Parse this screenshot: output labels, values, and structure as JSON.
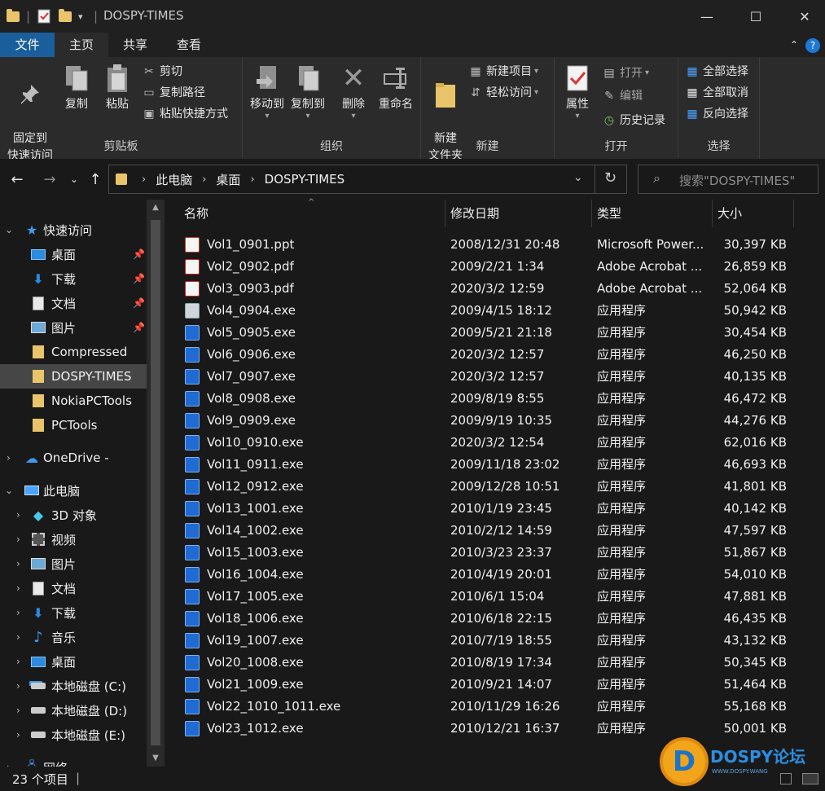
{
  "window": {
    "title": "DOSPY-TIMES",
    "minimize": "—",
    "maximize": "☐",
    "close": "✕"
  },
  "ribbon_tabs": [
    "文件",
    "主页",
    "共享",
    "查看"
  ],
  "ribbon": {
    "clipboard": {
      "label": "剪贴板",
      "pin": "固定到\n快速访问",
      "copy": "复制",
      "paste": "粘贴",
      "cut": "剪切",
      "copy_path": "复制路径",
      "paste_shortcut": "粘贴快捷方式"
    },
    "organize": {
      "label": "组织",
      "move_to": "移动到",
      "copy_to": "复制到",
      "delete": "删除",
      "rename": "重命名"
    },
    "new": {
      "label": "新建",
      "new_folder": "新建\n文件夹",
      "new_item": "新建项目",
      "easy_access": "轻松访问"
    },
    "open": {
      "label": "打开",
      "properties": "属性",
      "open": "打开",
      "edit": "编辑",
      "history": "历史记录"
    },
    "select": {
      "label": "选择",
      "select_all": "全部选择",
      "select_none": "全部取消",
      "invert": "反向选择"
    }
  },
  "address": {
    "crumbs": [
      "此电脑",
      "桌面",
      "DOSPY-TIMES"
    ],
    "search_placeholder": "搜索\"DOSPY-TIMES\""
  },
  "nav": {
    "quick_access": "快速访问",
    "quick_items": [
      "桌面",
      "下载",
      "文档",
      "图片",
      "Compressed",
      "DOSPY-TIMES",
      "NokiaPCTools",
      "PCTools"
    ],
    "onedrive": "OneDrive -",
    "this_pc": "此电脑",
    "pc_items": [
      "3D 对象",
      "视频",
      "图片",
      "文档",
      "下载",
      "音乐",
      "桌面",
      "本地磁盘 (C:)",
      "本地磁盘 (D:)",
      "本地磁盘 (E:)"
    ],
    "network": "网络"
  },
  "columns": [
    "名称",
    "修改日期",
    "类型",
    "大小"
  ],
  "files": [
    {
      "name": "Vol1_0901.ppt",
      "date": "2008/12/31 20:48",
      "type": "Microsoft Power...",
      "size": "30,397 KB",
      "icon": "ppt"
    },
    {
      "name": "Vol2_0902.pdf",
      "date": "2009/2/21 1:34",
      "type": "Adobe Acrobat ...",
      "size": "26,859 KB",
      "icon": "pdf"
    },
    {
      "name": "Vol3_0903.pdf",
      "date": "2020/3/2 12:59",
      "type": "Adobe Acrobat ...",
      "size": "52,064 KB",
      "icon": "pdf"
    },
    {
      "name": "Vol4_0904.exe",
      "date": "2009/4/15 18:12",
      "type": "应用程序",
      "size": "50,942 KB",
      "icon": "exe2"
    },
    {
      "name": "Vol5_0905.exe",
      "date": "2009/5/21 21:18",
      "type": "应用程序",
      "size": "30,454 KB",
      "icon": "exe"
    },
    {
      "name": "Vol6_0906.exe",
      "date": "2020/3/2 12:57",
      "type": "应用程序",
      "size": "46,250 KB",
      "icon": "exe"
    },
    {
      "name": "Vol7_0907.exe",
      "date": "2020/3/2 12:57",
      "type": "应用程序",
      "size": "40,135 KB",
      "icon": "exe"
    },
    {
      "name": "Vol8_0908.exe",
      "date": "2009/8/19 8:55",
      "type": "应用程序",
      "size": "46,472 KB",
      "icon": "exe"
    },
    {
      "name": "Vol9_0909.exe",
      "date": "2009/9/19 10:35",
      "type": "应用程序",
      "size": "44,276 KB",
      "icon": "exe"
    },
    {
      "name": "Vol10_0910.exe",
      "date": "2020/3/2 12:54",
      "type": "应用程序",
      "size": "62,016 KB",
      "icon": "exe"
    },
    {
      "name": "Vol11_0911.exe",
      "date": "2009/11/18 23:02",
      "type": "应用程序",
      "size": "46,693 KB",
      "icon": "exe"
    },
    {
      "name": "Vol12_0912.exe",
      "date": "2009/12/28 10:51",
      "type": "应用程序",
      "size": "41,801 KB",
      "icon": "exe"
    },
    {
      "name": "Vol13_1001.exe",
      "date": "2010/1/19 23:45",
      "type": "应用程序",
      "size": "40,142 KB",
      "icon": "exe"
    },
    {
      "name": "Vol14_1002.exe",
      "date": "2010/2/12 14:59",
      "type": "应用程序",
      "size": "47,597 KB",
      "icon": "exe"
    },
    {
      "name": "Vol15_1003.exe",
      "date": "2010/3/23 23:37",
      "type": "应用程序",
      "size": "51,867 KB",
      "icon": "exe"
    },
    {
      "name": "Vol16_1004.exe",
      "date": "2010/4/19 20:01",
      "type": "应用程序",
      "size": "54,010 KB",
      "icon": "exe"
    },
    {
      "name": "Vol17_1005.exe",
      "date": "2010/6/1 15:04",
      "type": "应用程序",
      "size": "47,881 KB",
      "icon": "exe"
    },
    {
      "name": "Vol18_1006.exe",
      "date": "2010/6/18 22:15",
      "type": "应用程序",
      "size": "46,435 KB",
      "icon": "exe"
    },
    {
      "name": "Vol19_1007.exe",
      "date": "2010/7/19 18:55",
      "type": "应用程序",
      "size": "43,132 KB",
      "icon": "exe"
    },
    {
      "name": "Vol20_1008.exe",
      "date": "2010/8/19 17:34",
      "type": "应用程序",
      "size": "50,345 KB",
      "icon": "exe"
    },
    {
      "name": "Vol21_1009.exe",
      "date": "2010/9/21 14:07",
      "type": "应用程序",
      "size": "51,464 KB",
      "icon": "exe"
    },
    {
      "name": "Vol22_1010_1011.exe",
      "date": "2010/11/29 16:26",
      "type": "应用程序",
      "size": "55,168 KB",
      "icon": "exe"
    },
    {
      "name": "Vol23_1012.exe",
      "date": "2010/12/21 16:37",
      "type": "应用程序",
      "size": "50,001 KB",
      "icon": "exe"
    }
  ],
  "status": {
    "count": "23 个项目",
    "separator": "|"
  },
  "watermark": {
    "logo_letter": "D",
    "brand": "DOSPY论坛",
    "sub": "WWW.DOSPY.WANG"
  },
  "colors": {
    "accent": "#1a5f9c",
    "bg": "#191919",
    "ribbon": "#2b2b2b",
    "folder": "#e9c46a"
  }
}
